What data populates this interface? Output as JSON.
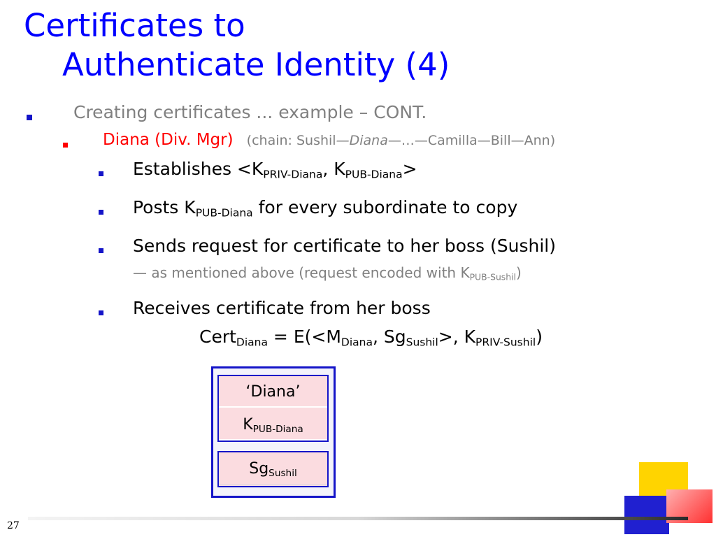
{
  "slide": {
    "title_line1": "Certificates to",
    "title_line2": "Authenticate Identity (4)",
    "bullet1": "Creating certificates ... example – CONT.",
    "sub_head": "Diana (Div. Mgr)",
    "chain_prefix": "(chain: Sushil",
    "chain_dash1": "—",
    "chain_diana": "Diana",
    "chain_rest": "—…—Camilla—Bill—Ann)",
    "item1": {
      "prefix": "Establishes <K",
      "sub1": "PRIV-Diana",
      "mid": ", K",
      "sub2": "PUB-Diana",
      "suffix": ">"
    },
    "item2": {
      "prefix": "Posts K",
      "sub1": "PUB-Diana",
      "suffix": " for every subordinate to copy"
    },
    "item3": {
      "text": "Sends request for certificate to her boss (Sushil)",
      "note_prefix": "— as mentioned above (request encoded with K",
      "note_sub": "PUB-Sushil",
      "note_suffix": ")"
    },
    "item4": {
      "text": "Receives certificate from her boss",
      "f_cert": "Cert",
      "f_cert_sub": "Diana",
      "f_eq": " = E(<M",
      "f_m_sub": "Diana",
      "f_sg": ", Sg",
      "f_sg_sub": "Sushil",
      "f_k": ">, K",
      "f_k_sub": "PRIV-Sushil",
      "f_end": ")"
    },
    "page_number": "27"
  },
  "certificate": {
    "name": "‘Diana’",
    "key_main": "K",
    "key_sub": "PUB-Diana",
    "sig_main": "Sg",
    "sig_sub": "Sushil"
  },
  "colors": {
    "title": "#0000ff",
    "accent_red": "#ff0000",
    "bullet_blue": "#1414c8",
    "gray_text": "#808080",
    "cert_fill": "#fbdce0",
    "deco_yellow": "#ffd400",
    "deco_blue": "#2020d0",
    "deco_red": "#ff4040"
  }
}
